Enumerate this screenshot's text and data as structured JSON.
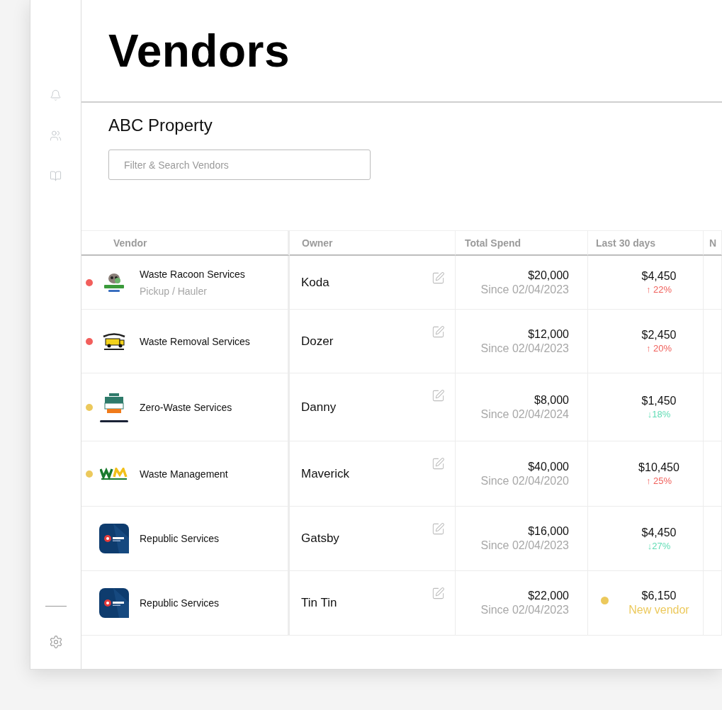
{
  "header": {
    "title": "Vendors"
  },
  "property": {
    "name": "ABC Property"
  },
  "search": {
    "placeholder": "Filter & Search Vendors"
  },
  "table": {
    "columns": [
      "Vendor",
      "Owner",
      "Total Spend",
      "Last 30 days",
      "N"
    ],
    "rows": [
      {
        "vendor": "Waste Racoon Services",
        "category": "Pickup / Hauler",
        "logo": {
          "kind": "raccoon"
        },
        "color": "#f25f5c",
        "owner": "Koda",
        "total": "$20,000",
        "since": "Since 02/04/2023",
        "last30": "$4,450",
        "change": {
          "kind": "up",
          "text": "↑ 22%"
        }
      },
      {
        "vendor": "Waste Removal Services",
        "logo": {
          "kind": "truck"
        },
        "color": "#f25f5c",
        "owner": "Dozer",
        "total": "$12,000",
        "since": "Since 02/04/2023",
        "last30": "$2,450",
        "change": {
          "kind": "up",
          "text": "↑ 20%"
        }
      },
      {
        "vendor": "Zero-Waste Services",
        "logo": {
          "kind": "bin"
        },
        "color": "#ecc95c",
        "owner": "Danny",
        "total": "$8,000",
        "since": "Since 02/04/2024",
        "last30": "$1,450",
        "change": {
          "kind": "down",
          "text": "↓18%"
        }
      },
      {
        "vendor": "Waste Management",
        "logo": {
          "kind": "wm"
        },
        "color": "#ecc95c",
        "owner": "Maverick",
        "total": "$40,000",
        "since": "Since 02/04/2020",
        "last30": "$10,450",
        "change": {
          "kind": "up",
          "text": "↑ 25%"
        }
      },
      {
        "vendor": "Republic Services",
        "logo": {
          "kind": "republic"
        },
        "owner": "Gatsby",
        "total": "$16,000",
        "since": "Since 02/04/2023",
        "last30": "$4,450",
        "change": {
          "kind": "down",
          "text": "↓27%"
        }
      },
      {
        "vendor": "Republic Services",
        "logo": {
          "kind": "republic"
        },
        "owner": "Tin Tin",
        "total": "$22,000",
        "since": "Since 02/04/2023",
        "last30": "$6,150",
        "change": {
          "kind": "new",
          "text": "New vendor",
          "color": "#ecc95c"
        }
      }
    ]
  }
}
